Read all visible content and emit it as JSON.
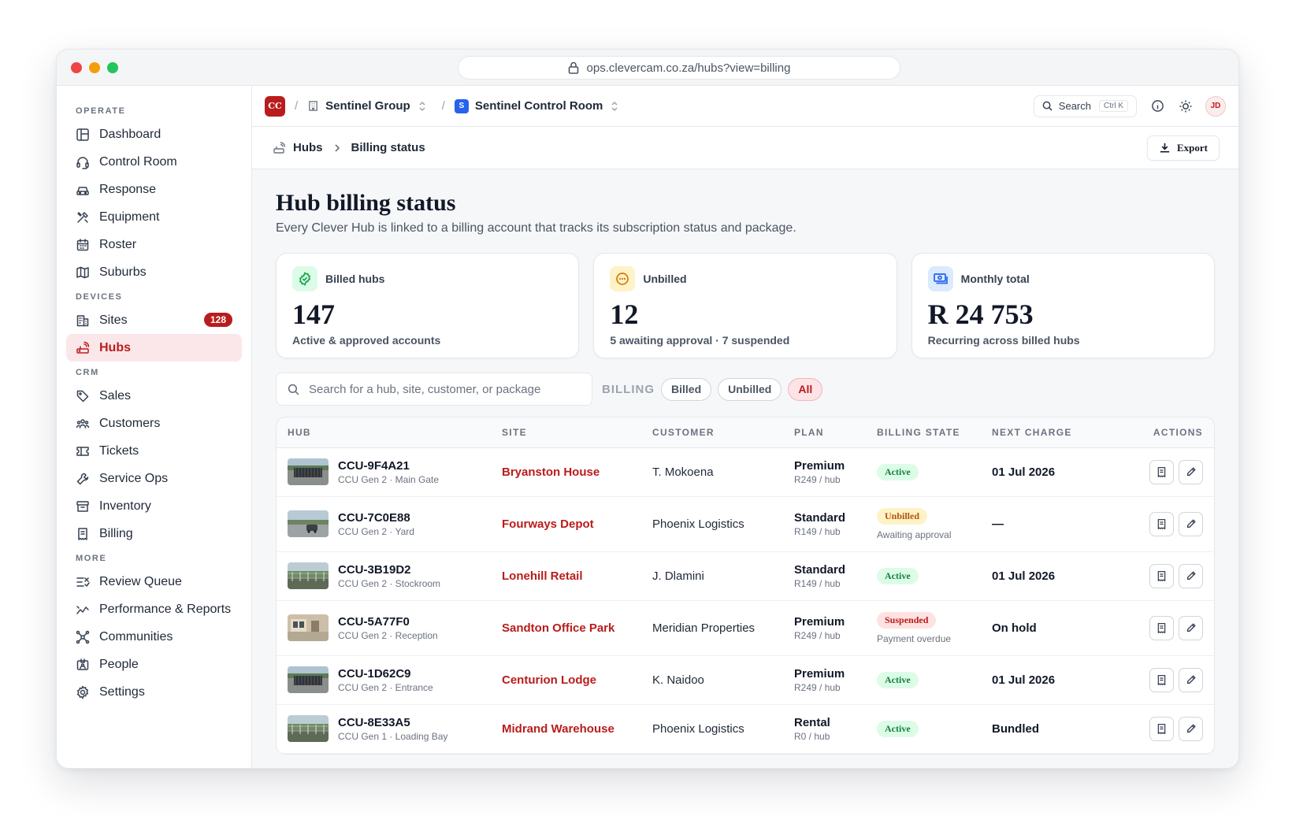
{
  "browser": {
    "url": "ops.clevercam.co.za/hubs?view=billing"
  },
  "sidebar": {
    "sections": [
      {
        "title": "OPERATE",
        "items": [
          {
            "label": "Dashboard",
            "icon": "layout-icon"
          },
          {
            "label": "Control Room",
            "icon": "headset-icon"
          },
          {
            "label": "Response",
            "icon": "car-icon"
          },
          {
            "label": "Equipment",
            "icon": "tools-icon"
          },
          {
            "label": "Roster",
            "icon": "calendar-icon"
          },
          {
            "label": "Suburbs",
            "icon": "map-icon"
          }
        ]
      },
      {
        "title": "DEVICES",
        "items": [
          {
            "label": "Sites",
            "icon": "building-icon",
            "badge": "128"
          },
          {
            "label": "Hubs",
            "icon": "router-icon",
            "active": true
          }
        ]
      },
      {
        "title": "CRM",
        "items": [
          {
            "label": "Sales",
            "icon": "tag-icon"
          },
          {
            "label": "Customers",
            "icon": "users-icon"
          },
          {
            "label": "Tickets",
            "icon": "ticket-icon"
          },
          {
            "label": "Service Ops",
            "icon": "wrench-icon"
          },
          {
            "label": "Inventory",
            "icon": "archive-icon"
          },
          {
            "label": "Billing",
            "icon": "receipt-icon"
          }
        ]
      },
      {
        "title": "MORE",
        "items": [
          {
            "label": "Review Queue",
            "icon": "list-check-icon"
          },
          {
            "label": "Performance & Reports",
            "icon": "trend-icon"
          },
          {
            "label": "Communities",
            "icon": "network-icon"
          },
          {
            "label": "People",
            "icon": "id-card-icon"
          },
          {
            "label": "Settings",
            "icon": "gear-icon"
          }
        ]
      }
    ]
  },
  "topbar": {
    "logo": "CC",
    "org": "Sentinel Group",
    "room_badge": "S",
    "room": "Sentinel Control Room",
    "search_label": "Search",
    "search_shortcut": "Ctrl K",
    "avatar": "JD"
  },
  "subbar": {
    "crumb_root": "Hubs",
    "crumb_current": "Billing status",
    "export_label": "Export"
  },
  "page": {
    "title": "Hub billing status",
    "subtitle": "Every Clever Hub is linked to a billing account that tracks its subscription status and package."
  },
  "stats": [
    {
      "label": "Billed hubs",
      "value": "147",
      "note": "Active & approved accounts",
      "icon": "check-badge-icon",
      "bg": "#dcfce7",
      "fg": "#16a34a"
    },
    {
      "label": "Unbilled",
      "value": "12",
      "note": "5 awaiting approval · 7 suspended",
      "icon": "dots-circle-icon",
      "bg": "#fef3c7",
      "fg": "#d97706"
    },
    {
      "label": "Monthly total",
      "value": "R 24 753",
      "note": "Recurring across billed hubs",
      "icon": "money-icon",
      "bg": "#dbeafe",
      "fg": "#2563eb"
    }
  ],
  "filters": {
    "search_placeholder": "Search for a hub, site, customer, or package",
    "label": "BILLING",
    "chips": [
      "Billed",
      "Unbilled",
      "All"
    ],
    "active_chip": "All"
  },
  "table": {
    "columns": [
      "HUB",
      "SITE",
      "CUSTOMER",
      "PLAN",
      "BILLING STATE",
      "NEXT CHARGE",
      "ACTIONS"
    ],
    "rows": [
      {
        "hub": "CCU-9F4A21",
        "hub_sub": "CCU Gen 2 · Main Gate",
        "site": "Bryanston House",
        "customer": "T. Mokoena",
        "plan": "Premium",
        "price": "R249 / hub",
        "state": "Active",
        "state_kind": "active",
        "state_note": "",
        "next": "01 Jul 2026",
        "thumb": "gate"
      },
      {
        "hub": "CCU-7C0E88",
        "hub_sub": "CCU Gen 2 · Yard",
        "site": "Fourways Depot",
        "customer": "Phoenix Logistics",
        "plan": "Standard",
        "price": "R149 / hub",
        "state": "Unbilled",
        "state_kind": "unbilled",
        "state_note": "Awaiting approval",
        "next": "—",
        "thumb": "yard"
      },
      {
        "hub": "CCU-3B19D2",
        "hub_sub": "CCU Gen 2 · Stockroom",
        "site": "Lonehill Retail",
        "customer": "J. Dlamini",
        "plan": "Standard",
        "price": "R149 / hub",
        "state": "Active",
        "state_kind": "active",
        "state_note": "",
        "next": "01 Jul 2026",
        "thumb": "fence"
      },
      {
        "hub": "CCU-5A77F0",
        "hub_sub": "CCU Gen 2 · Reception",
        "site": "Sandton Office Park",
        "customer": "Meridian Properties",
        "plan": "Premium",
        "price": "R249 / hub",
        "state": "Suspended",
        "state_kind": "suspended",
        "state_note": "Payment overdue",
        "next": "On hold",
        "thumb": "building"
      },
      {
        "hub": "CCU-1D62C9",
        "hub_sub": "CCU Gen 2 · Entrance",
        "site": "Centurion Lodge",
        "customer": "K. Naidoo",
        "plan": "Premium",
        "price": "R249 / hub",
        "state": "Active",
        "state_kind": "active",
        "state_note": "",
        "next": "01 Jul 2026",
        "thumb": "gate"
      },
      {
        "hub": "CCU-8E33A5",
        "hub_sub": "CCU Gen 1 · Loading Bay",
        "site": "Midrand Warehouse",
        "customer": "Phoenix Logistics",
        "plan": "Rental",
        "price": "R0 / hub",
        "state": "Active",
        "state_kind": "active",
        "state_note": "",
        "next": "Bundled",
        "thumb": "fence"
      }
    ]
  }
}
